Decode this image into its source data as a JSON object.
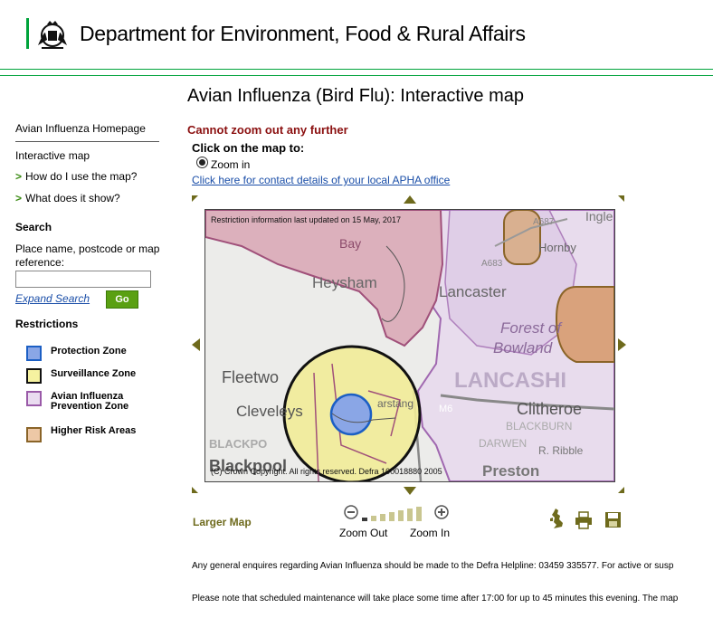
{
  "header": {
    "org_name": "Department for Environment, Food & Rural Affairs",
    "accent_color": "#00a33b"
  },
  "page_title": "Avian Influenza (Bird Flu): Interactive map",
  "sidebar": {
    "home_link": "Avian Influenza Homepage",
    "map_label": "Interactive map",
    "links": [
      {
        "label": "How do I use the map?"
      },
      {
        "label": "What does it show?"
      }
    ],
    "search": {
      "heading": "Search",
      "label": "Place name, postcode or map reference:",
      "input_value": "",
      "expand_label": "Expand Search",
      "go_label": "Go"
    },
    "restrictions": {
      "heading": "Restrictions",
      "items": [
        {
          "label": "Protection Zone",
          "fill": "#8aa6e6",
          "border": "#1c5fc4"
        },
        {
          "label": "Surveillance Zone",
          "fill": "#f6f2a0",
          "border": "#111111"
        },
        {
          "label": "Avian Influenza Prevention Zone",
          "fill": "#eadcf0",
          "border": "#9a5aa8"
        },
        {
          "label": "Higher Risk Areas",
          "fill": "#edc8a6",
          "border": "#8a6428"
        }
      ]
    }
  },
  "main": {
    "error_message": "Cannot zoom out any further",
    "click_heading": "Click on the map to:",
    "radio_label": "Zoom in",
    "radio_selected": true,
    "apha_link": "Click here for contact details of your local APHA office"
  },
  "map": {
    "updated_text": "Restriction information last updated on 15 May, 2017",
    "copyright": "(C) Crown Copyright. All rights reserved. Defra 100018880 2005",
    "place_labels": {
      "morecambe_bay": "Bay",
      "heysham": "Heysham",
      "lancaster": "Lancaster",
      "forest_of": "Forest of",
      "bowland": "Bowland",
      "fleetwood": "Fleetwo",
      "cleveleys": "Cleveleys",
      "lancashire": "LANCASHI",
      "clitheroe": "Clitheroe",
      "blackburn": "BLACKBURN",
      "darwen": "DARWEN",
      "blackpool_caps": "BLACKPO",
      "blackpool": "Blackpool",
      "preston": "Preston",
      "hornby": "Hornby",
      "road_a687": "A687",
      "road_a683": "A683",
      "motorway_m6": "M6",
      "ingleton": "Ingle",
      "garstang": "arstang",
      "river_ribble": "R. Ribble"
    }
  },
  "controls": {
    "larger_map": "Larger Map",
    "zoom_out": "Zoom Out",
    "zoom_in": "Zoom In",
    "zoom_level": 1,
    "zoom_levels": 7
  },
  "footer": {
    "line1": "Any general enquires regarding Avian Influenza should be made to the Defra Helpline: 03459 335577. For active or susp",
    "line2": "Please note that scheduled maintenance will take place some time after 17:00 for up to 45 minutes this evening. The map"
  }
}
